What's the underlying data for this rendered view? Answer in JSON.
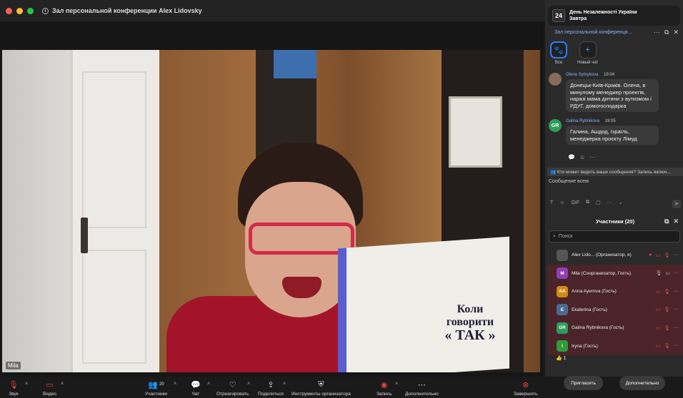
{
  "window": {
    "title": "Зал персональной конференции Alex Lidovsky"
  },
  "notification": {
    "day": "24",
    "title": "День Незалежності України",
    "subtitle": "Завтра"
  },
  "chat": {
    "header_title": "Зал персональной конференци...",
    "tabs": [
      {
        "label": "Все"
      },
      {
        "label": "Новый чат"
      }
    ],
    "messages": [
      {
        "name": "Olena Sytnykova",
        "time": "19:04",
        "text": "Донецьк-Київ-Краків. Олена, в минулому менеджер проектів, наразі мама дитини з аутизмом і РДУГ, домогосподарка"
      },
      {
        "name": "Galina Rybnikova",
        "time": "19:05",
        "avatar": "GR",
        "text": "Галина, Ашдод, Ізраїль, менеджерка проєкту Лімуд"
      }
    ],
    "who_can_see": "Кто может видеть ваши сообщения? Запись включ...",
    "input_placeholder": "Сообщение всем",
    "gif_label": "GIF"
  },
  "participants": {
    "title": "Участники (20)",
    "search_placeholder": "Поиск",
    "list": [
      {
        "name": "Alex Lido... (Организатор, я)",
        "avatar": "",
        "color": "#555555"
      },
      {
        "name": "Mila (Соорганизатор, Гость)",
        "avatar": "M",
        "color": "#8e3fb5"
      },
      {
        "name": "Anna Ayerova (Гость)",
        "avatar": "AA",
        "color": "#d48a17"
      },
      {
        "name": "Ekaterina (Гость)",
        "avatar": "E",
        "color": "#4a6a8f"
      },
      {
        "name": "Galina Rybnikova (Гость)",
        "avatar": "GR",
        "color": "#2e9d5a"
      },
      {
        "name": "Iryna (Гость)",
        "avatar": "I",
        "color": "#2e9d3a"
      }
    ],
    "reaction": "👍 1",
    "invite_label": "Пригласить",
    "more_label": "Дополнительно"
  },
  "video": {
    "speaker_label": "Mila",
    "book_title_1": "Коли",
    "book_title_2": "говорити",
    "book_title_3": "« ТАК »"
  },
  "toolbar": {
    "audio": "Звук",
    "video": "Видео",
    "participants": "Участники",
    "participants_count": "20",
    "chat": "Чат",
    "react": "Отреагировать",
    "share": "Поделиться",
    "host_tools": "Инструменты организатора",
    "record": "Запись",
    "more": "Дополнительно",
    "end": "Завершить"
  }
}
